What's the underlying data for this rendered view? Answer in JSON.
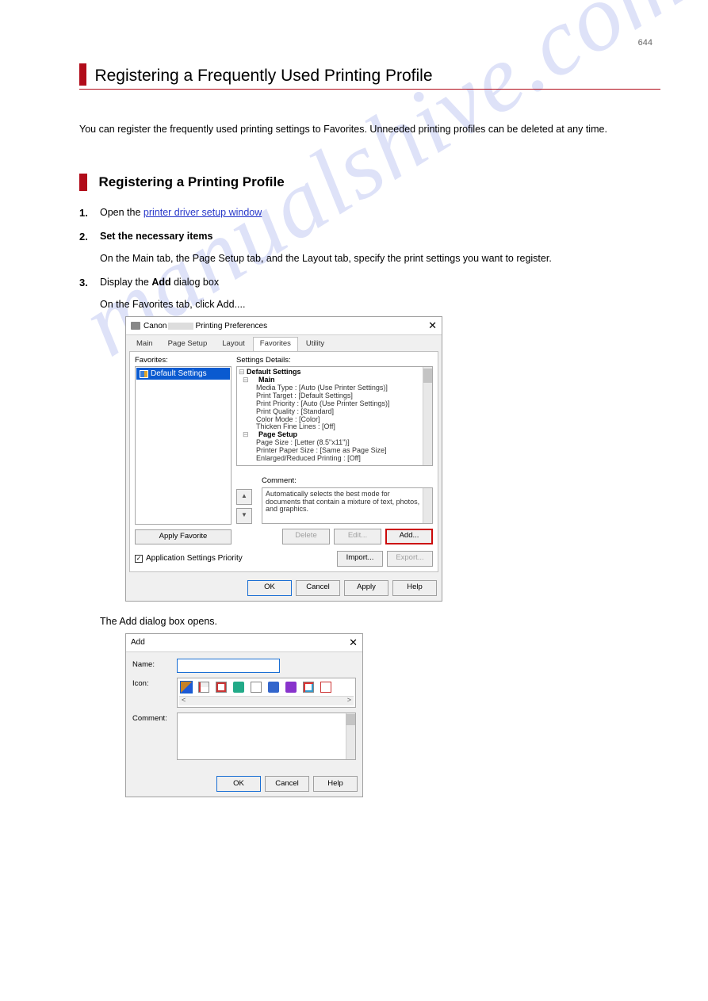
{
  "page_number": "644",
  "watermark": "manualshive.com",
  "title": "Registering a Frequently Used Printing Profile",
  "intro": "You can register the frequently used printing settings to Favorites. Unneeded printing profiles can be deleted at any time.",
  "section_title": "Registering a Printing Profile",
  "steps": {
    "s1_a": "Open the ",
    "s1_link": "printer driver setup window",
    "s2": "Set the necessary items",
    "s2_sub1": "On the Main tab, the Page Setup tab, and the Layout tab, specify the print settings you want to register.",
    "s3_a": "Display the ",
    "s3_b": "Add",
    "s3_c": " dialog box",
    "s3_sub1": "On the Favorites tab, click Add....",
    "s3_sub2": "The Add dialog box opens."
  },
  "prefs_dialog": {
    "title_prefix": "Canon ",
    "title_suffix": " Printing Preferences",
    "tabs": {
      "main": "Main",
      "pagesetup": "Page Setup",
      "layout": "Layout",
      "favorites": "Favorites",
      "utility": "Utility"
    },
    "favorites_label": "Favorites:",
    "settings_details_label": "Settings Details:",
    "selected_favorite": "Default Settings",
    "tree": {
      "root": "Default Settings",
      "sec1": "Main",
      "s1_1": "Media Type : [Auto (Use Printer Settings)]",
      "s1_2": "Print Target : [Default Settings]",
      "s1_3": "Print Priority : [Auto (Use Printer Settings)]",
      "s1_4": "Print Quality : [Standard]",
      "s1_5": "Color Mode : [Color]",
      "s1_6": "Thicken Fine Lines : [Off]",
      "sec2": "Page Setup",
      "s2_1": "Page Size : [Letter (8.5\"x11\")]",
      "s2_2": "Printer Paper Size : [Same as Page Size]",
      "s2_3": "Enlarged/Reduced Printing : [Off]"
    },
    "comment_label": "Comment:",
    "comment_text": "Automatically selects the best mode for documents that contain a mixture of text, photos, and graphics.",
    "apply_favorite": "Apply Favorite",
    "delete_btn": "Delete",
    "edit_btn": "Edit...",
    "add_btn": "Add...",
    "app_settings_priority": "Application Settings Priority",
    "import_btn": "Import...",
    "export_btn": "Export...",
    "ok": "OK",
    "cancel": "Cancel",
    "apply": "Apply",
    "help": "Help"
  },
  "add_dialog": {
    "title": "Add",
    "name_label": "Name:",
    "icon_label": "Icon:",
    "comment_label": "Comment:",
    "ok": "OK",
    "cancel": "Cancel",
    "help": "Help"
  }
}
